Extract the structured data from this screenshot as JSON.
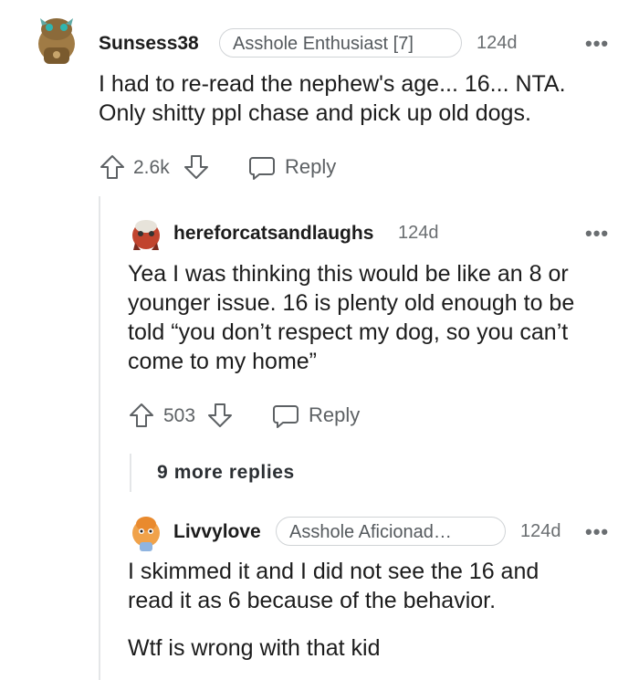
{
  "comments": [
    {
      "username": "Sunsess38",
      "flair": "Asshole Enthusiast [7]",
      "time": "124d",
      "more_label": "•••",
      "body": [
        "I had to re-read the nephew's age... 16... NTA.",
        "Only shitty ppl chase and pick up old dogs."
      ],
      "votes": "2.6k",
      "reply_label": "Reply",
      "avatar_icon": "snoo-avatar-icon"
    },
    {
      "username": "hereforcatsandlaughs",
      "time": "124d",
      "more_label": "•••",
      "body": [
        "Yea I was thinking this would be like an 8 or",
        "younger issue. 16 is plenty old enough to be",
        "told “you don’t respect my dog, so you can’t",
        "come to my home”"
      ],
      "votes": "503",
      "reply_label": "Reply",
      "avatar_icon": "snoo-avatar-icon"
    },
    {
      "username": "Livvylove",
      "flair": "Asshole Aficionad…",
      "time": "124d",
      "more_label": "•••",
      "body": [
        "I skimmed it and I did not see the 16 and",
        "read it as 6 because of the behavior."
      ],
      "body2": "Wtf is wrong with that kid",
      "avatar_icon": "snoo-avatar-icon"
    }
  ],
  "more_replies_label": "9 more replies",
  "colors": {
    "text": "#1c1c1c",
    "meta": "#6a6e71",
    "line": "#e4e6e8"
  }
}
